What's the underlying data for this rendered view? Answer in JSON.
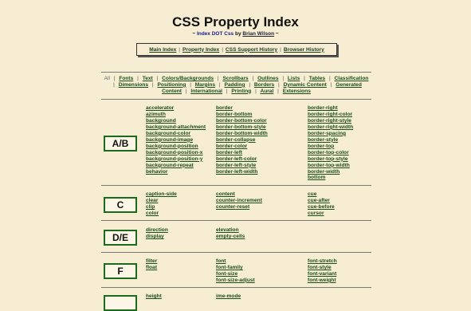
{
  "header": {
    "title": "CSS Property Index",
    "byline_prefix": "~",
    "byline_idx": "Index DOT Css",
    "byline_by": "by",
    "author": "Brian Wilson",
    "byline_suffix": "~"
  },
  "nav": {
    "items": [
      "Main Index",
      "Property Index",
      "CSS Support History",
      "Browser History"
    ]
  },
  "categories": {
    "all": "All",
    "items": [
      "Fonts",
      "Text",
      "Colors/Backgrounds",
      "Scrollbars",
      "Outlines",
      "Lists",
      "Tables",
      "Classification",
      "Dimensions",
      "Positioning",
      "Margins",
      "Padding",
      "Borders",
      "Dynamic Content",
      "Generated Content",
      "International",
      "Printing",
      "Aural",
      "Extensions"
    ]
  },
  "sections": [
    {
      "letter": "A/B",
      "cols": [
        [
          "accelerator",
          "azimuth",
          "background",
          "background-attachment",
          "background-color",
          "background-image",
          "background-position",
          "background-position-x",
          "background-position-y",
          "background-repeat",
          "behavior"
        ],
        [
          "border",
          "border-bottom",
          "border-bottom-color",
          "border-bottom-style",
          "border-bottom-width",
          "border-collapse",
          "border-color",
          "border-left",
          "border-left-color",
          "border-left-style",
          "border-left-width"
        ],
        [
          "border-right",
          "border-right-color",
          "border-right-style",
          "border-right-width",
          "border-spacing",
          "border-style",
          "border-top",
          "border-top-color",
          "border-top-style",
          "border-top-width",
          "border-width",
          "bottom"
        ]
      ]
    },
    {
      "letter": "C",
      "cols": [
        [
          "caption-side",
          "clear",
          "clip",
          "color"
        ],
        [
          "content",
          "counter-increment",
          "counter-reset"
        ],
        [
          "cue",
          "cue-after",
          "cue-before",
          "cursor"
        ]
      ]
    },
    {
      "letter": "D/E",
      "cols": [
        [
          "direction",
          "display"
        ],
        [
          "elevation",
          "empty-cells"
        ],
        []
      ]
    },
    {
      "letter": "F",
      "cols": [
        [
          "filter",
          "float"
        ],
        [
          "font",
          "font-family",
          "font-size",
          "font-size-adjust"
        ],
        [
          "font-stretch",
          "font-style",
          "font-variant",
          "font-weight"
        ]
      ]
    },
    {
      "letter": "",
      "cols": [
        [
          "height"
        ],
        [
          "ime-mode"
        ],
        []
      ]
    }
  ]
}
